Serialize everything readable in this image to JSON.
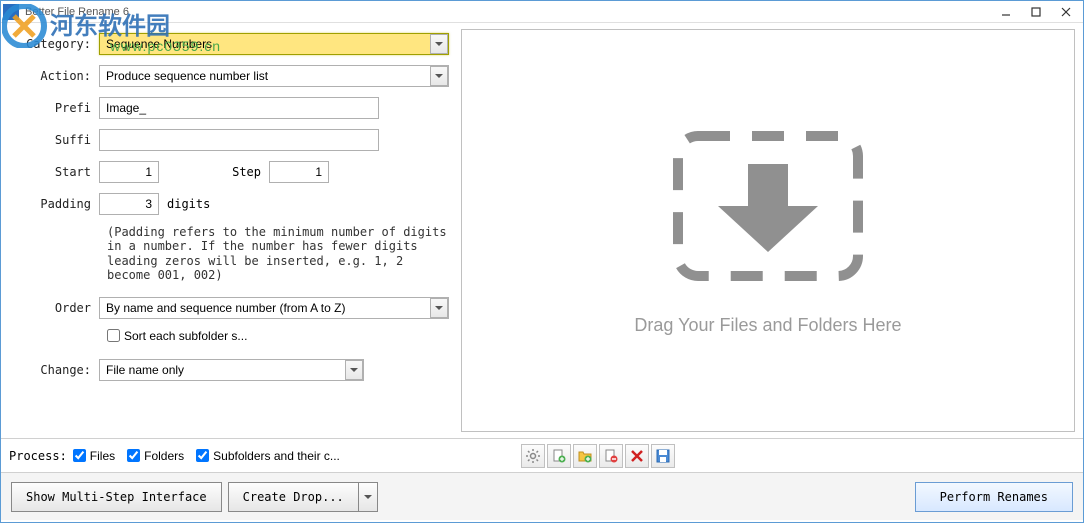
{
  "titlebar": {
    "title": "Better File Rename 6"
  },
  "watermark": {
    "site_name": "河东软件园",
    "url": "www.pc0359.cn"
  },
  "form": {
    "category_label": "Category:",
    "category_value": "Sequence Numbers",
    "action_label": "Action:",
    "action_value": "Produce sequence number list",
    "prefix_label": "Prefi",
    "prefix_value": "Image_",
    "suffix_label": "Suffi",
    "suffix_value": "",
    "start_label": "Start",
    "start_value": "1",
    "step_label": "Step",
    "step_value": "1",
    "padding_label": "Padding",
    "padding_value": "3",
    "digits_label": "digits",
    "padding_help": "(Padding refers to the minimum number of digits in a number. If the number has fewer digits leading zeros will be inserted, e.g. 1, 2 become 001, 002)",
    "order_label": "Order",
    "order_value": "By name and sequence number (from A to Z)",
    "sort_subfolder_label": "Sort each subfolder s...",
    "change_label": "Change:",
    "change_value": "File name only"
  },
  "dropzone": {
    "text": "Drag Your Files and Folders Here"
  },
  "process": {
    "label": "Process:",
    "files": "Files",
    "folders": "Folders",
    "subfolders": "Subfolders and their c..."
  },
  "buttons": {
    "multi_step": "Show Multi-Step Interface",
    "create_drop": "Create Drop...",
    "perform": "Perform Renames"
  }
}
